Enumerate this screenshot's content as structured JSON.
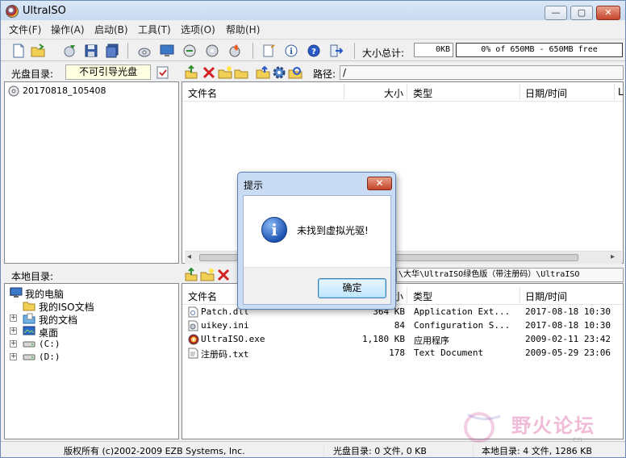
{
  "window": {
    "title": "UltraISO"
  },
  "menu": [
    "文件(F)",
    "操作(A)",
    "启动(B)",
    "工具(T)",
    "选项(O)",
    "帮助(H)"
  ],
  "toolbar": {
    "size_total_label": "大小总计:",
    "size_total_value": "0KB",
    "capacity": "0% of 650MB - 650MB free"
  },
  "disc": {
    "label": "光盘目录:",
    "boot_status": "不可引导光盘",
    "path_label": "路径:",
    "path_value": "/",
    "root": "20170818_105408",
    "columns": [
      "文件名",
      "大小",
      "类型",
      "日期/时间",
      "L"
    ]
  },
  "local": {
    "label": "本地目录:",
    "path_value": "\\大华\\UltraISO绿色版（带注册码）\\UltraISO",
    "tree": [
      {
        "label": "我的电脑",
        "icon": "computer-icon",
        "expander": "−"
      },
      {
        "label": "我的ISO文档",
        "icon": "folder-icon",
        "expander": ""
      },
      {
        "label": "我的文档",
        "icon": "documents-icon",
        "expander": "+"
      },
      {
        "label": "桌面",
        "icon": "desktop-icon",
        "expander": "+"
      },
      {
        "label": "(C:)",
        "icon": "drive-icon",
        "expander": "+"
      },
      {
        "label": "(D:)",
        "icon": "drive-icon",
        "expander": "+"
      }
    ],
    "columns": [
      "文件名",
      "大小",
      "类型",
      "日期/时间"
    ],
    "files": [
      {
        "name": "Patch.dll",
        "size": "364 KB",
        "type": "Application Ext...",
        "date": "2017-08-18 10:30",
        "icon": "dll-icon"
      },
      {
        "name": "uikey.ini",
        "size": "84",
        "type": "Configuration S...",
        "date": "2017-08-18 10:30",
        "icon": "ini-icon"
      },
      {
        "name": "UltraISO.exe",
        "size": "1,180 KB",
        "type": "应用程序",
        "date": "2009-02-11 23:42",
        "icon": "exe-icon"
      },
      {
        "name": "注册码.txt",
        "size": "178",
        "type": "Text Document",
        "date": "2009-05-29 23:06",
        "icon": "txt-icon"
      }
    ]
  },
  "status": {
    "copyright": "版权所有 (c)2002-2009 EZB Systems, Inc.",
    "disc_summary": "光盘目录: 0 文件, 0 KB",
    "local_summary": "本地目录: 4 文件, 1286 KB"
  },
  "dialog": {
    "title": "提示",
    "message": "未找到虚拟光驱!",
    "ok_label": "确定",
    "close_glyph": "✕"
  },
  "watermark": {
    "text": "野火论坛",
    "sub": "cn"
  }
}
